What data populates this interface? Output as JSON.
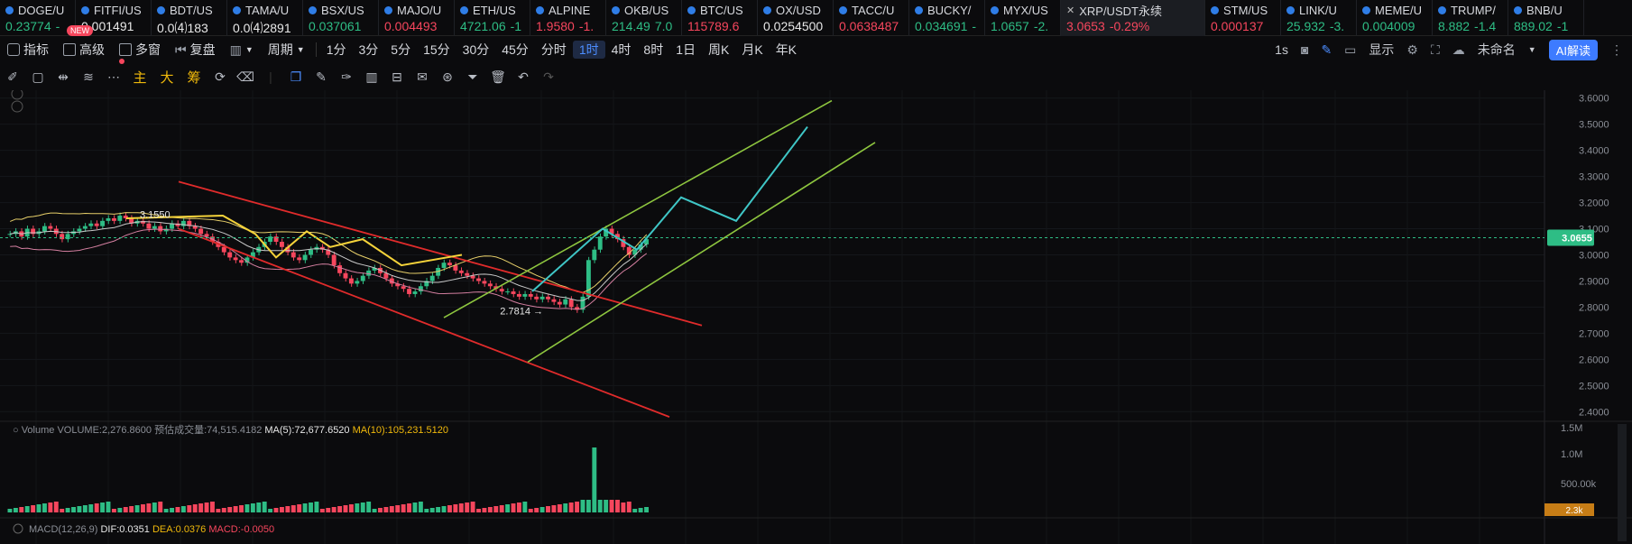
{
  "tickers": [
    {
      "sym": "DOGE/U",
      "price": "0.23774",
      "chg": "-",
      "dir": "up"
    },
    {
      "sym": "FITFI/US",
      "price": "0.001491",
      "chg": "",
      "dir": "wh"
    },
    {
      "sym": "BDT/US",
      "price": "0.0⑷183",
      "chg": "",
      "dir": "wh"
    },
    {
      "sym": "TAMA/U",
      "price": "0.0⑷2891",
      "chg": "",
      "dir": "wh"
    },
    {
      "sym": "BSX/US",
      "price": "0.037061",
      "chg": "",
      "dir": "up"
    },
    {
      "sym": "MAJO/U",
      "price": "0.004493",
      "chg": "",
      "dir": "dn"
    },
    {
      "sym": "ETH/US",
      "price": "4721.06",
      "chg": "-1",
      "dir": "up"
    },
    {
      "sym": "ALPINE",
      "price": "1.9580",
      "chg": "-1.",
      "dir": "dn"
    },
    {
      "sym": "OKB/US",
      "price": "214.49",
      "chg": "7.0",
      "dir": "up"
    },
    {
      "sym": "BTC/US",
      "price": "115789.6",
      "chg": "",
      "dir": "dn"
    },
    {
      "sym": "OX/USD",
      "price": "0.0254500",
      "chg": "",
      "dir": "wh"
    },
    {
      "sym": "TACC/U",
      "price": "0.0638487",
      "chg": "",
      "dir": "dn"
    },
    {
      "sym": "BUCKY/",
      "price": "0.034691",
      "chg": "-",
      "dir": "up"
    },
    {
      "sym": "MYX/US",
      "price": "1.0657",
      "chg": "-2.",
      "dir": "up"
    },
    {
      "sym": "XRP/USDT永续",
      "price": "3.0653",
      "chg": "-0.29%",
      "dir": "dn",
      "active": true
    },
    {
      "sym": "STM/US",
      "price": "0.000137",
      "chg": "",
      "dir": "dn"
    },
    {
      "sym": "LINK/U",
      "price": "25.932",
      "chg": "-3.",
      "dir": "up"
    },
    {
      "sym": "MEME/U",
      "price": "0.004009",
      "chg": "",
      "dir": "up"
    },
    {
      "sym": "TRUMP/",
      "price": "8.882",
      "chg": "-1.4",
      "dir": "up"
    },
    {
      "sym": "BNB/U",
      "price": "889.02",
      "chg": "-1",
      "dir": "up"
    }
  ],
  "new_badge": "NEW",
  "toolbar1": {
    "indicators": "指标",
    "advanced": "高级",
    "multi": "多窗",
    "replay": "复盘",
    "period": "周期",
    "timeframes": [
      "1分",
      "3分",
      "5分",
      "15分",
      "30分",
      "45分",
      "分时",
      "1时",
      "4时",
      "8时",
      "1日",
      "周K",
      "月K",
      "年K"
    ],
    "active_tf": "1时",
    "speed": "1s",
    "display": "显示",
    "unnamed": "未命名",
    "ai": "AI解读"
  },
  "toolbar2": {
    "main": "主",
    "big": "大",
    "chips": "筹"
  },
  "colors": {
    "up": "#2ebd85",
    "down": "#f6465d",
    "accent": "#3d7bff",
    "gold": "#f0b90b"
  },
  "chart_data": {
    "type": "candlestick",
    "symbol": "XRP/USDT永续",
    "interval": "1时",
    "last_price": "3.0655",
    "price_ticks": [
      "3.6000",
      "3.5000",
      "3.4000",
      "3.3000",
      "3.2000",
      "3.1000",
      "3.0000",
      "2.9000",
      "2.8000",
      "2.7000",
      "2.6000",
      "2.5000",
      "2.4000"
    ],
    "ylim": [
      2.37,
      3.63
    ],
    "high_label": "3.1550",
    "low_label": "2.7814 →",
    "close": [
      3.08,
      3.09,
      3.07,
      3.1,
      3.08,
      3.09,
      3.11,
      3.1,
      3.08,
      3.06,
      3.08,
      3.09,
      3.1,
      3.11,
      3.12,
      3.11,
      3.13,
      3.14,
      3.13,
      3.15,
      3.14,
      3.12,
      3.13,
      3.12,
      3.1,
      3.11,
      3.09,
      3.1,
      3.12,
      3.11,
      3.13,
      3.11,
      3.1,
      3.08,
      3.07,
      3.05,
      3.03,
      3.01,
      2.99,
      2.98,
      2.97,
      2.99,
      3.01,
      3.03,
      3.05,
      3.07,
      3.05,
      3.03,
      3.01,
      2.99,
      2.98,
      3.0,
      3.02,
      3.03,
      3.02,
      3.0,
      2.96,
      2.93,
      2.91,
      2.89,
      2.9,
      2.92,
      2.94,
      2.95,
      2.93,
      2.91,
      2.89,
      2.88,
      2.87,
      2.85,
      2.86,
      2.88,
      2.9,
      2.92,
      2.95,
      2.97,
      2.96,
      2.94,
      2.93,
      2.92,
      2.91,
      2.9,
      2.89,
      2.88,
      2.87,
      2.86,
      2.86,
      2.85,
      2.84,
      2.85,
      2.84,
      2.83,
      2.84,
      2.83,
      2.82,
      2.81,
      2.83,
      2.8,
      2.79,
      2.84,
      2.98,
      3.02,
      3.07,
      3.1,
      3.08,
      3.06,
      3.03,
      3.0,
      3.02,
      3.04,
      3.06
    ],
    "channels": [
      {
        "name": "down-upper",
        "color": "#e02b2b",
        "points": [
          [
            200,
            2.16
          ],
          [
            775,
            3.0
          ]
        ]
      },
      {
        "name": "down-lower",
        "color": "#e02b2b",
        "points": [
          [
            200,
            0
          ],
          [
            775,
            0
          ]
        ]
      }
    ],
    "volume": {
      "label": "Volume",
      "volume": "VOLUME:2,276.8600",
      "forecast": "预估成交量:74,515.4182",
      "ma5": "MA(5):72,677.6520",
      "ma10": "MA(10):105,231.5120",
      "ticks": [
        "1.5M",
        "1.0M",
        "500.00k"
      ],
      "current": "2.3k"
    },
    "macd": {
      "label": "MACD(12,26,9)",
      "dif": "DIF:0.0351",
      "dea": "DEA:0.0376",
      "macd": "MACD:-0.0050"
    }
  }
}
